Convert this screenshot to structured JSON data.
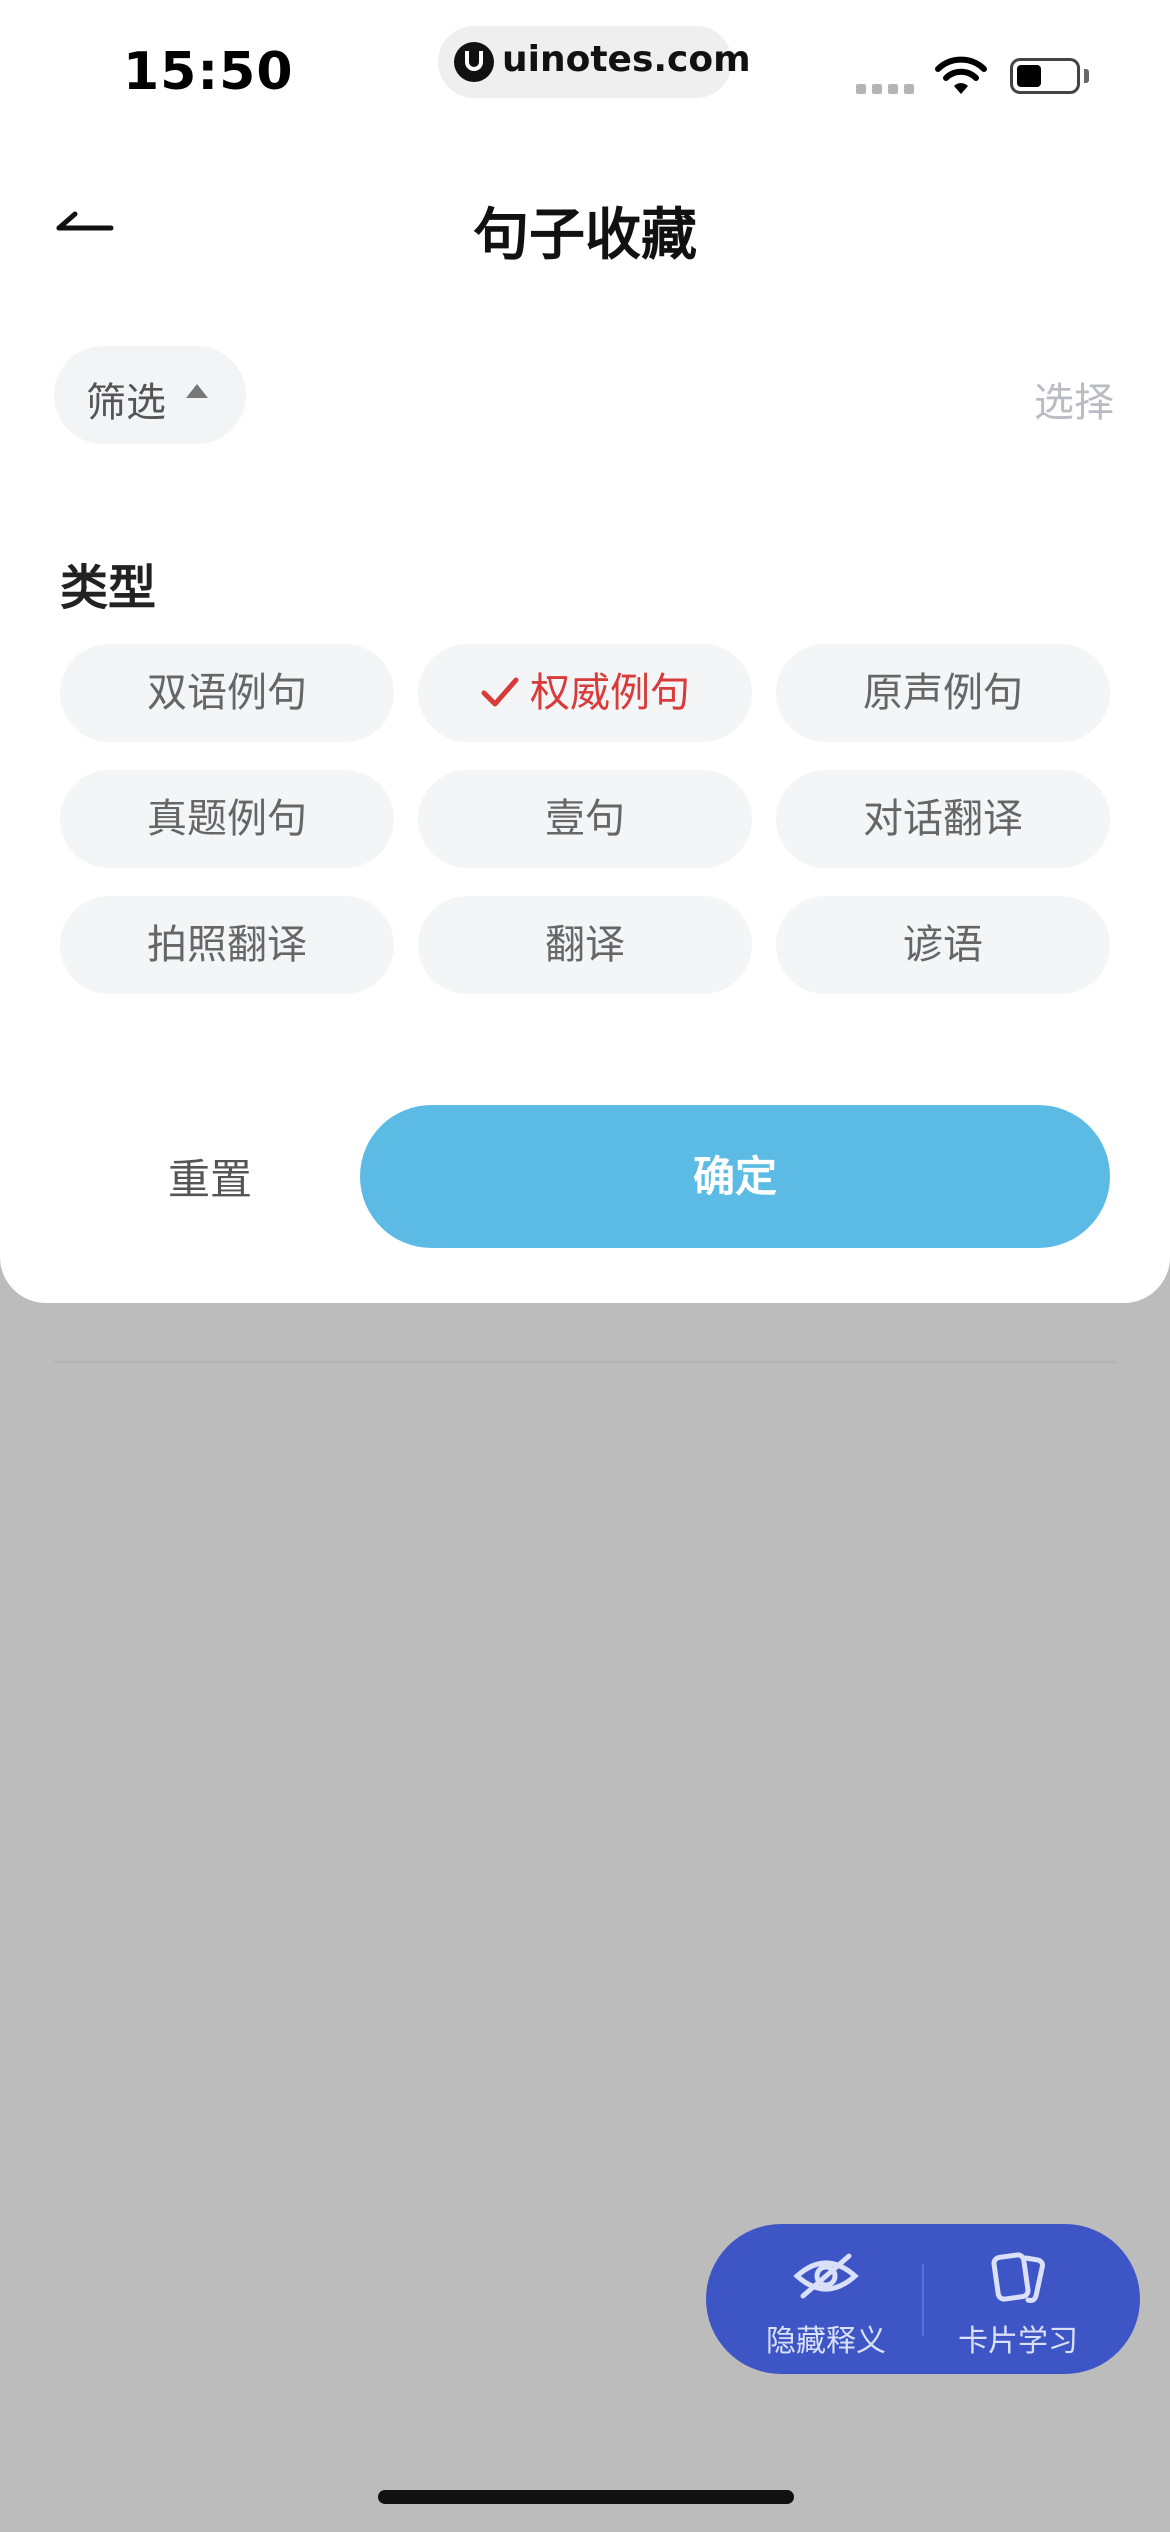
{
  "status_bar": {
    "time": "15:50",
    "url": "uinotes.com"
  },
  "header": {
    "title": "句子收藏",
    "back_icon": "arrow-left-icon"
  },
  "toolbar": {
    "filter_label": "筛选",
    "select_label": "选择"
  },
  "filter_panel": {
    "section_title": "类型",
    "options": [
      {
        "label": "双语例句",
        "selected": false
      },
      {
        "label": "权威例句",
        "selected": true
      },
      {
        "label": "原声例句",
        "selected": false
      },
      {
        "label": "真题例句",
        "selected": false
      },
      {
        "label": "壹句",
        "selected": false
      },
      {
        "label": "对话翻译",
        "selected": false
      },
      {
        "label": "拍照翻译",
        "selected": false
      },
      {
        "label": "翻译",
        "selected": false
      },
      {
        "label": "谚语",
        "selected": false
      }
    ],
    "reset_label": "重置",
    "confirm_label": "确定"
  },
  "background": {
    "partial_text": "………"
  },
  "fab": {
    "hide_label": "隐藏释义",
    "card_label": "卡片学习"
  },
  "colors": {
    "accent": "#5bbbe5",
    "selected": "#d93a3a",
    "fab": "#3e55c6"
  }
}
